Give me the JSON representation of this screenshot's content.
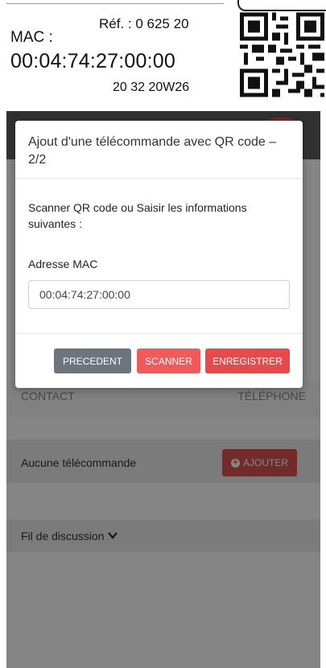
{
  "label": {
    "ref": "Réf. : 0 625 20",
    "mac_label": "MAC :",
    "mac_value": "00:04:74:27:00:00",
    "code": "20  32 20W26"
  },
  "modal": {
    "title": "Ajout d'une télécommande avec QR code – 2/2",
    "instruction": "Scanner QR code ou Saisir les informations suivantes :",
    "mac_field_label": "Adresse MAC",
    "mac_field_value": "00:04:74:27:00:00",
    "buttons": {
      "previous": "PRECEDENT",
      "scan": "SCANNER",
      "save": "ENREGISTRER"
    }
  },
  "background": {
    "contact_header": "CONTACT",
    "telephone_header": "TÉLÉPHONE",
    "no_remote": "Aucune télécommande",
    "add_button": "AJOUTER",
    "thread": "Fil de discussion"
  },
  "icons": {
    "add": "plus-circle-icon",
    "thread_toggle": "chevron-down-icon",
    "qr": "qr-code-icon"
  },
  "colors": {
    "danger": "#e54b4b",
    "secondary": "#6c757d"
  }
}
